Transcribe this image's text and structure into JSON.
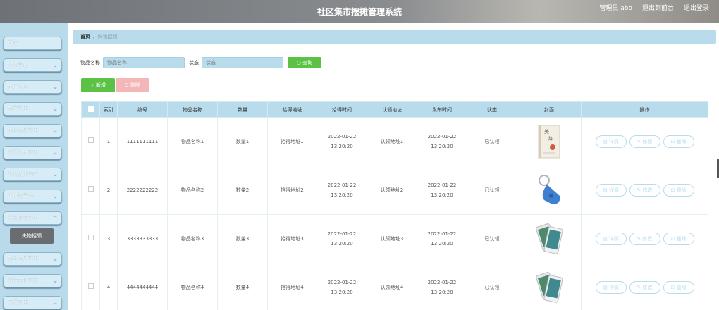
{
  "header": {
    "title": "社区集市摆摊管理系统",
    "user": "管理员 abo",
    "front": "退出到前台",
    "logout": "退出登录"
  },
  "sidebar": {
    "items": [
      {
        "label": "首页"
      },
      {
        "label": "个人中心"
      },
      {
        "label": "用户管理"
      },
      {
        "label": "商家管理"
      },
      {
        "label": "摊位信息管理"
      },
      {
        "label": "清洁人员管理"
      },
      {
        "label": "收入统计管理"
      },
      {
        "label": "出租公告管理"
      },
      {
        "label": "失物招领管理"
      },
      {
        "label": "商品信息管理"
      },
      {
        "label": "清洁安排管理"
      },
      {
        "label": "系统管理"
      }
    ],
    "sub_item": "失物招领"
  },
  "breadcrumb": {
    "home": "首页",
    "sep": "/",
    "current": "失物招领"
  },
  "search": {
    "name_label": "物品名称",
    "name_placeholder": "物品名称",
    "status_label": "状态",
    "status_placeholder": "状态",
    "query": "查询"
  },
  "actions": {
    "add": "新增",
    "delete": "删除"
  },
  "table": {
    "headers": [
      "",
      "索引",
      "编号",
      "物品名称",
      "数量",
      "拾得地址",
      "拾得时间",
      "认领地址",
      "发布时间",
      "状态",
      "封面",
      "操作"
    ],
    "rows": [
      {
        "index": "1",
        "code": "1111111111",
        "name": "物品名称1",
        "qty": "数量1",
        "found_addr": "拾得地址1",
        "found_time": "2022-01-22 13:20:20",
        "claim_addr": "认领地址1",
        "pub_time": "2022-01-22 13:20:20",
        "status": "已认领",
        "cover": "book-cover"
      },
      {
        "index": "2",
        "code": "2222222222",
        "name": "物品名称2",
        "qty": "数量2",
        "found_addr": "拾得地址2",
        "found_time": "2022-01-22 13:20:20",
        "claim_addr": "认领地址2",
        "pub_time": "2022-01-22 13:20:20",
        "status": "已认领",
        "cover": "keyfob"
      },
      {
        "index": "3",
        "code": "3333333333",
        "name": "物品名称3",
        "qty": "数量3",
        "found_addr": "拾得地址3",
        "found_time": "2022-01-22 13:20:20",
        "claim_addr": "认领地址3",
        "pub_time": "2022-01-22 13:20:20",
        "status": "已认领",
        "cover": "phone"
      },
      {
        "index": "4",
        "code": "4444444444",
        "name": "物品名称4",
        "qty": "数量4",
        "found_addr": "拾得地址4",
        "found_time": "2022-01-22 13:20:20",
        "claim_addr": "认领地址4",
        "pub_time": "2022-01-22 13:20:20",
        "status": "已认领",
        "cover": "phone"
      }
    ],
    "ops": {
      "detail": "详情",
      "edit": "修改",
      "delete": "删除"
    }
  },
  "colors": {
    "accent": "#b8dcec",
    "green": "#5cc246",
    "pink": "#f3b7b7"
  }
}
